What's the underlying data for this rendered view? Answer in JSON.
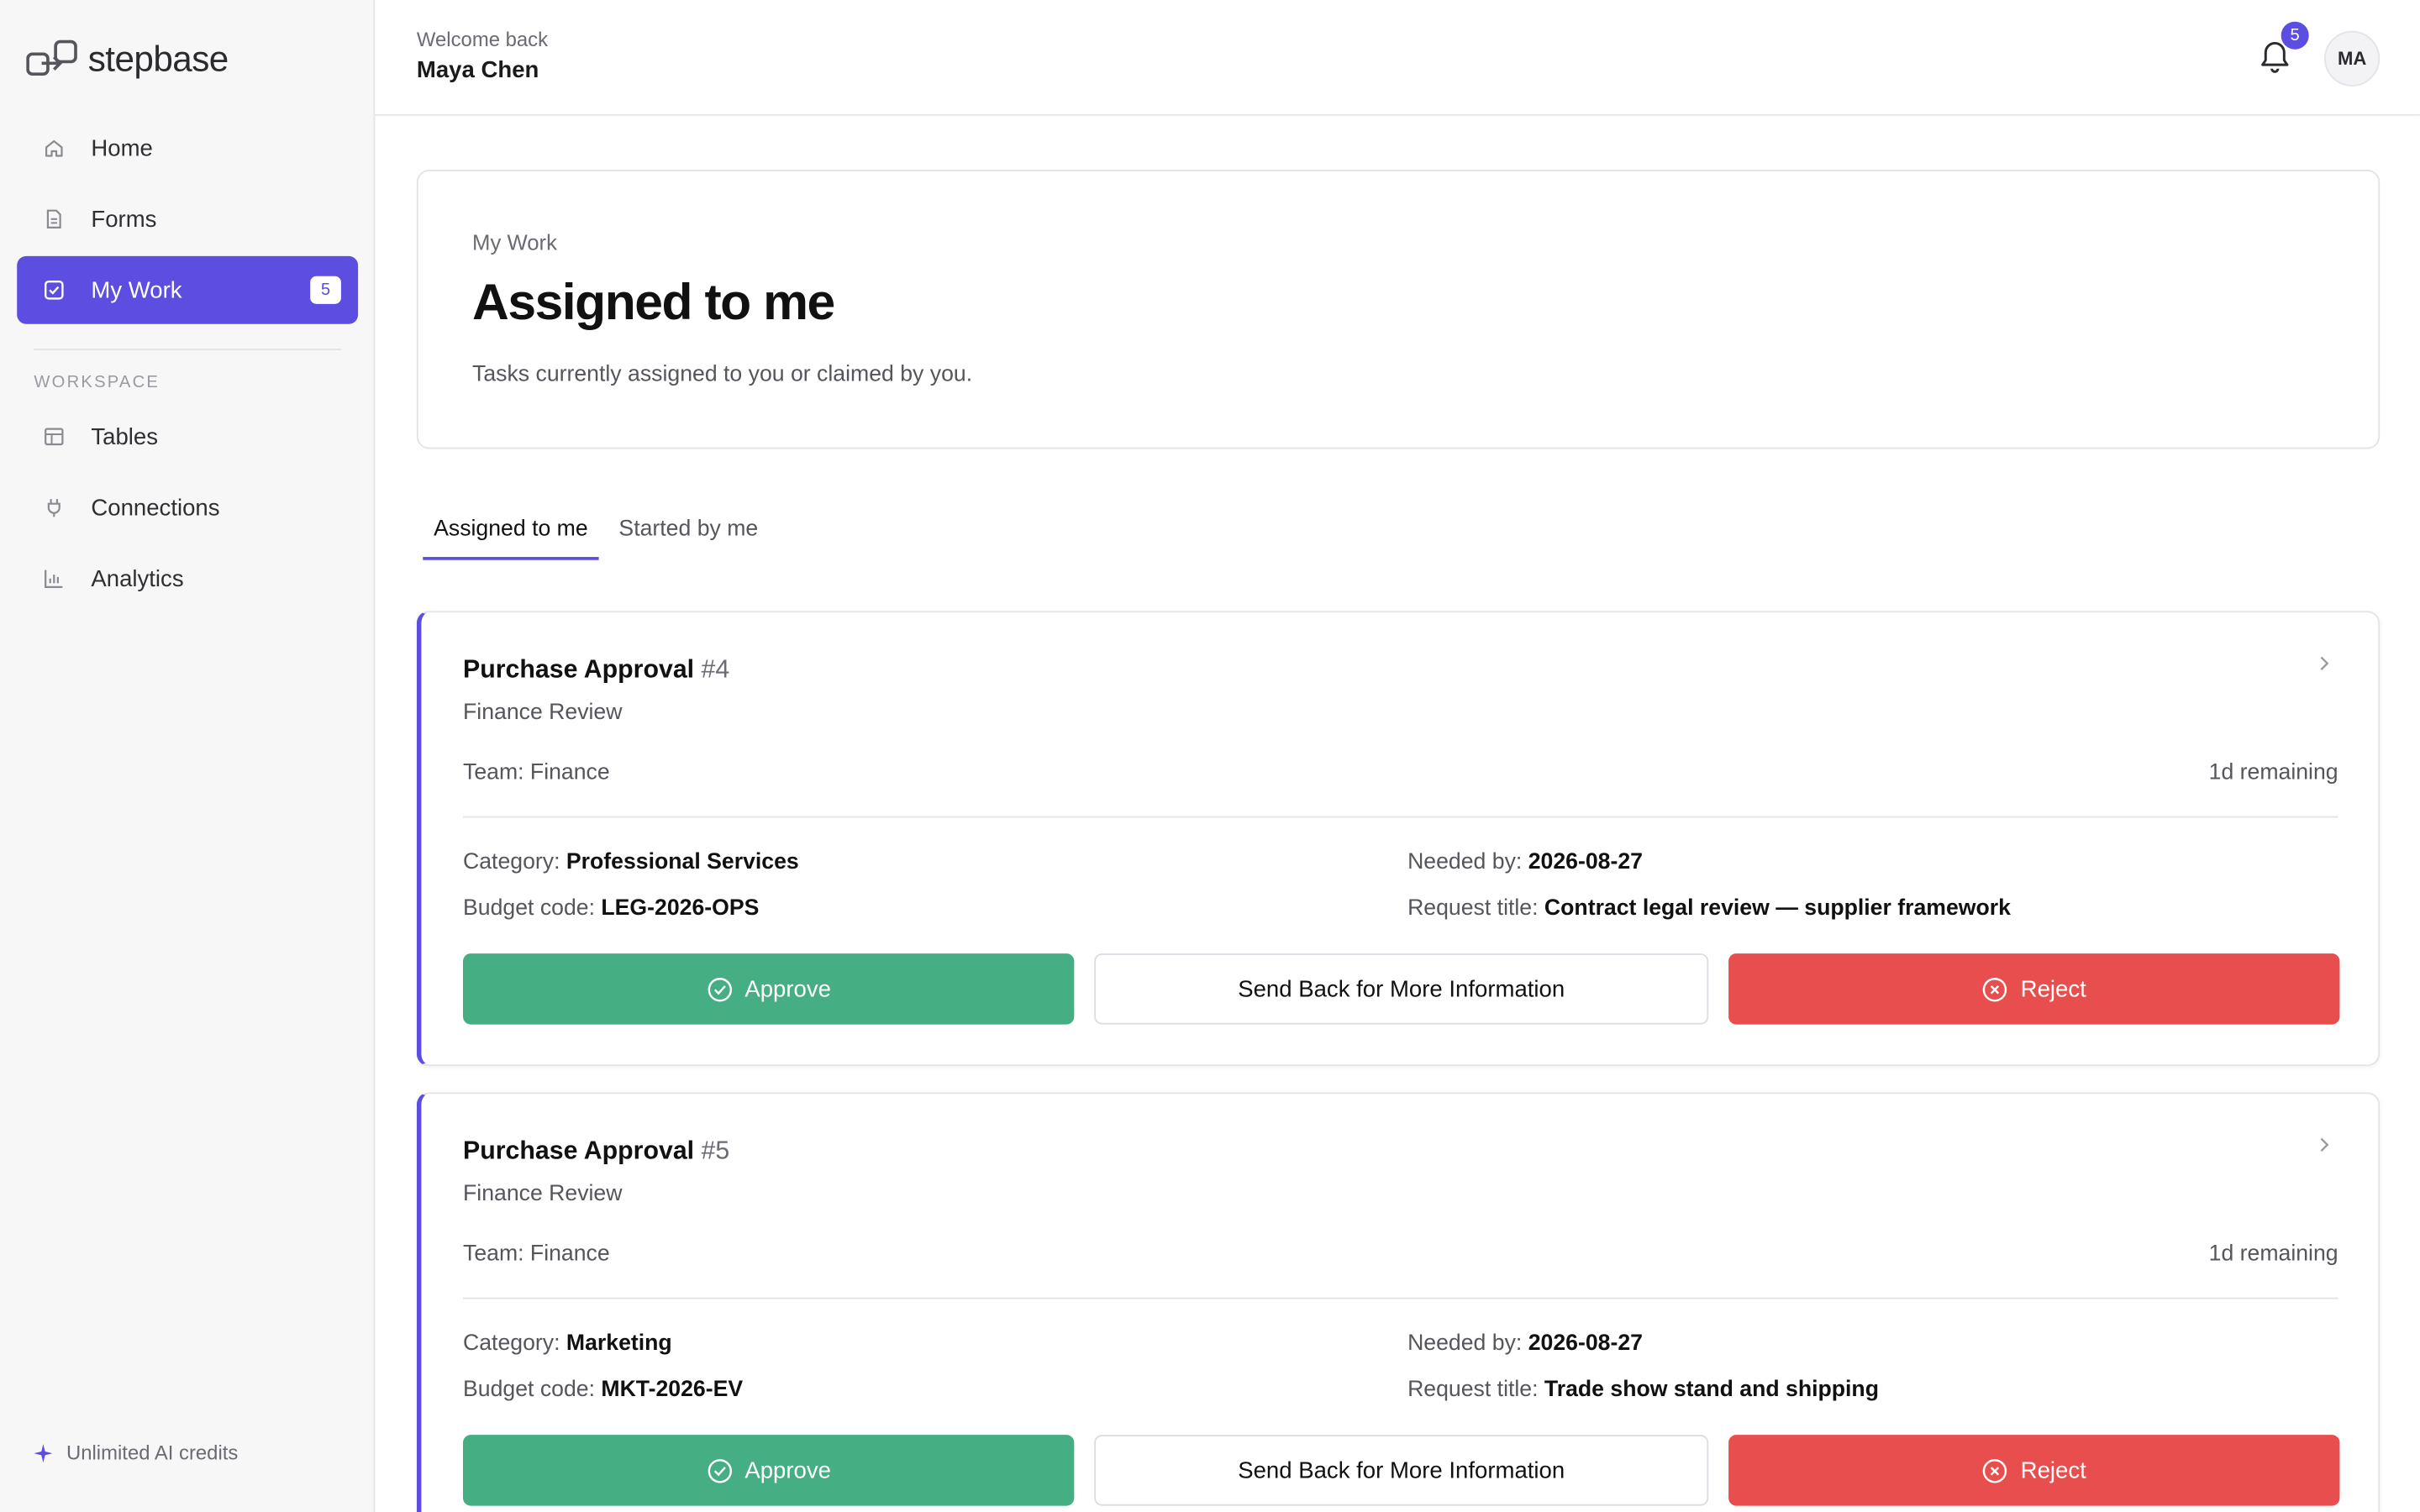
{
  "brand": {
    "name": "stepbase"
  },
  "sidebar": {
    "items": [
      {
        "label": "Home",
        "icon": "home-icon"
      },
      {
        "label": "Forms",
        "icon": "document-icon"
      },
      {
        "label": "My Work",
        "icon": "check-square-icon",
        "count": "5",
        "active": true
      }
    ],
    "section_label": "WORKSPACE",
    "workspace_items": [
      {
        "label": "Tables",
        "icon": "table-icon"
      },
      {
        "label": "Connections",
        "icon": "plug-icon"
      },
      {
        "label": "Analytics",
        "icon": "bar-chart-icon"
      }
    ],
    "footer": "Unlimited AI credits"
  },
  "header": {
    "welcome": "Welcome back",
    "user_name": "Maya Chen",
    "notification_count": "5",
    "avatar_initials": "MA"
  },
  "hero": {
    "crumb": "My Work",
    "title": "Assigned to me",
    "subtitle": "Tasks currently assigned to you or claimed by you."
  },
  "tabs": [
    {
      "label": "Assigned to me",
      "active": true
    },
    {
      "label": "Started by me",
      "active": false
    }
  ],
  "cards": [
    {
      "title": "Purchase Approval",
      "number": "#4",
      "stage": "Finance Review",
      "team": "Team: Finance",
      "remaining": "1d remaining",
      "category_label": "Category:",
      "category": "Professional Services",
      "budget_label": "Budget code:",
      "budget": "LEG-2026-OPS",
      "needed_label": "Needed by:",
      "needed": "2026-08-27",
      "request_label": "Request title:",
      "request": "Contract legal review — supplier framework",
      "approve": "Approve",
      "send_back": "Send Back for More Information",
      "reject": "Reject"
    },
    {
      "title": "Purchase Approval",
      "number": "#5",
      "stage": "Finance Review",
      "team": "Team: Finance",
      "remaining": "1d remaining",
      "category_label": "Category:",
      "category": "Marketing",
      "budget_label": "Budget code:",
      "budget": "MKT-2026-EV",
      "needed_label": "Needed by:",
      "needed": "2026-08-27",
      "request_label": "Request title:",
      "request": "Trade show stand and shipping",
      "approve": "Approve",
      "send_back": "Send Back for More Information",
      "reject": "Reject"
    }
  ],
  "colors": {
    "accent": "#5b4ee0",
    "approve": "#45ae82",
    "reject": "#e84e4e"
  }
}
